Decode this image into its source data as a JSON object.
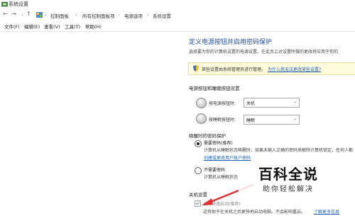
{
  "window": {
    "title": "系统设置"
  },
  "address": {
    "back": "←",
    "forward": "→",
    "up": "↑",
    "crumbs": [
      "控制面板",
      "所有控制面板项",
      "电源选项",
      "系统设置"
    ]
  },
  "menu": [
    "文件(F)",
    "编辑(E)",
    "查看(V)",
    "工具(T)",
    "帮助(H)"
  ],
  "main": {
    "title": "定义电源按钮并启用密码保护",
    "subtitle": "选择要为你的计算机设置的电源设置。在此页上对设置所做的更改将应用于你的",
    "banner": {
      "text": "某些设置由系统管理员进行管理。",
      "link": "为什么我无法更改某些设置?"
    },
    "power_section": {
      "title": "电源按钮和睡眠按钮设置",
      "power_button": {
        "label": "按电源按钮时:",
        "value": "关机"
      },
      "sleep_button": {
        "label": "按睡眠按钮时:",
        "value": "睡眠"
      }
    },
    "wake_section": {
      "title": "唤醒时的密码保护",
      "require": {
        "label": "需要密码(推荐)",
        "desc1": "计算机从睡眠状态唤醒时，如果未输入正确的密码来解除计算机锁定，任何人都",
        "link": "创建或更改用户帐户密码"
      },
      "norequire": {
        "label": "不需要密码",
        "desc1": "计算机从睡眠状态"
      }
    },
    "shutdown_section": {
      "title": "关机设置",
      "fast_startup": {
        "label": "启用快速启动(推荐)",
        "desc": "这有助于在关机之后更快地启动电脑。不会影响重启。",
        "link": "了解更多信息"
      }
    }
  },
  "watermark": {
    "title": "百科全说",
    "subtitle": "助你轻松解决"
  },
  "colors": {
    "accent": "#1e4d9a",
    "link": "#1a5fb4",
    "banner_bg": "#fffbdb",
    "arrow": "#e03030"
  }
}
